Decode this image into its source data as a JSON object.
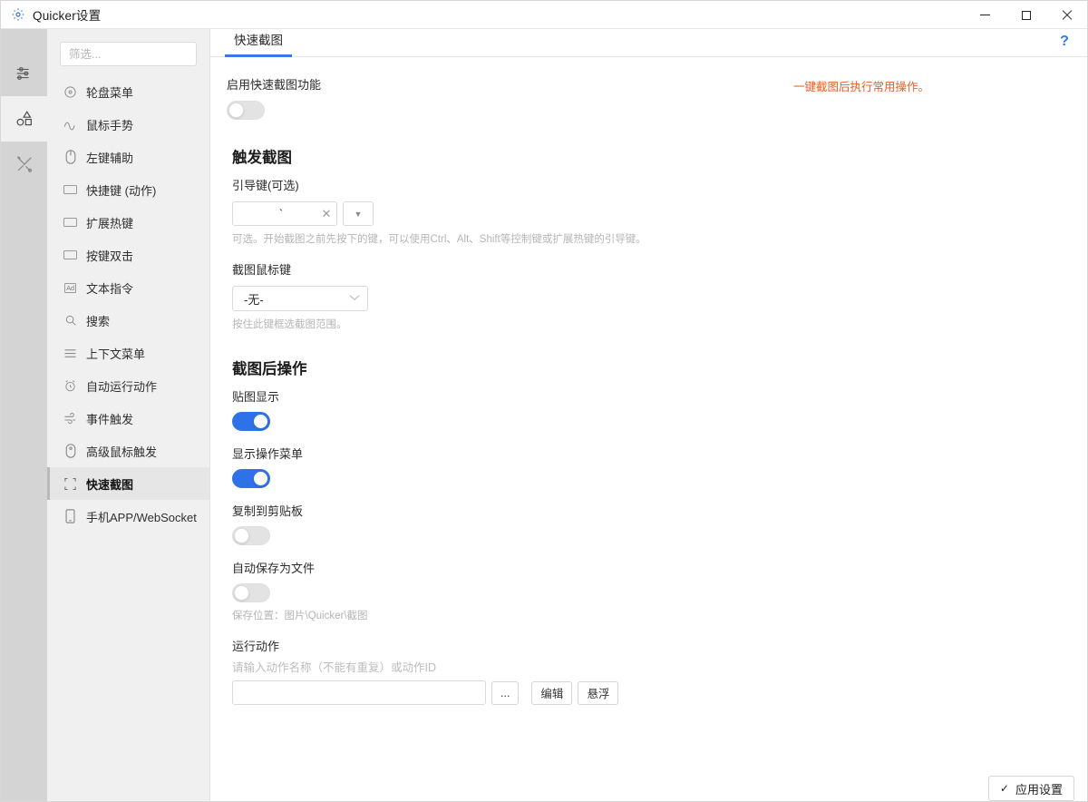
{
  "window": {
    "title": "Quicker设置",
    "app_icon": "gear-icon",
    "controls": {
      "minimize": "minimize-icon",
      "maximize": "maximize-icon",
      "close": "close-icon"
    }
  },
  "rail": {
    "items": [
      {
        "name": "sliders-icon",
        "active": false
      },
      {
        "name": "shapes-icon",
        "active": true
      },
      {
        "name": "tools-icon",
        "active": false
      }
    ]
  },
  "sidebar": {
    "filter_placeholder": "筛选...",
    "items": [
      {
        "label": "轮盘菜单",
        "icon": "target-icon",
        "selected": false
      },
      {
        "label": "鼠标手势",
        "icon": "gesture-icon",
        "selected": false
      },
      {
        "label": "左键辅助",
        "icon": "mouse-icon",
        "selected": false
      },
      {
        "label": "快捷键 (动作)",
        "icon": "keyboard-icon",
        "selected": false
      },
      {
        "label": "扩展热键",
        "icon": "keyboard-icon",
        "selected": false
      },
      {
        "label": "按键双击",
        "icon": "keyboard-icon",
        "selected": false
      },
      {
        "label": "文本指令",
        "icon": "ad-icon",
        "selected": false
      },
      {
        "label": "搜索",
        "icon": "search-icon",
        "selected": false
      },
      {
        "label": "上下文菜单",
        "icon": "menu-icon",
        "selected": false
      },
      {
        "label": "自动运行动作",
        "icon": "alarm-icon",
        "selected": false
      },
      {
        "label": "事件触发",
        "icon": "event-icon",
        "selected": false
      },
      {
        "label": "高级鼠标触发",
        "icon": "advanced-mouse-icon",
        "selected": false
      },
      {
        "label": "快速截图",
        "icon": "crop-icon",
        "selected": true
      },
      {
        "label": "手机APP/WebSocket",
        "icon": "phone-icon",
        "selected": false
      }
    ]
  },
  "main": {
    "tab_label": "快速截图",
    "help_icon": "?",
    "enable": {
      "label": "启用快速截图功能",
      "state": "off"
    },
    "note": "一键截图后执行常用操作。",
    "trigger": {
      "section_title": "触发截图",
      "guide_key_label": "引导键(可选)",
      "guide_key_value": "`",
      "guide_key_clear": "✕",
      "guide_key_dropdown": "▼",
      "guide_key_hint": "可选。开始截图之前先按下的键，可以使用Ctrl、Alt、Shift等控制键或扩展热键的引导键。",
      "mouse_key_label": "截图鼠标键",
      "mouse_key_value": "-无-",
      "mouse_key_hint": "按住此键框选截图范围。"
    },
    "after": {
      "section_title": "截图后操作",
      "toggles": [
        {
          "label": "贴图显示",
          "state": "on"
        },
        {
          "label": "显示操作菜单",
          "state": "on"
        },
        {
          "label": "复制到剪贴板",
          "state": "off"
        },
        {
          "label": "自动保存为文件",
          "state": "off"
        }
      ],
      "save_location_hint": "保存位置：图片\\Quicker\\截图",
      "run_action_label": "运行动作",
      "run_action_placeholder": "请输入动作名称（不能有重复）或动作ID",
      "run_action_value": "",
      "browse_button": "...",
      "edit_button": "编辑",
      "float_button": "悬浮"
    }
  },
  "footer": {
    "apply_label": "应用设置",
    "apply_check": "✓"
  },
  "colors": {
    "accent": "#2f72e8",
    "tab_underline": "#3b78e7",
    "note": "#ef5b25",
    "rail_bg": "#d4d4d4",
    "nav_bg": "#f0f0f0"
  }
}
